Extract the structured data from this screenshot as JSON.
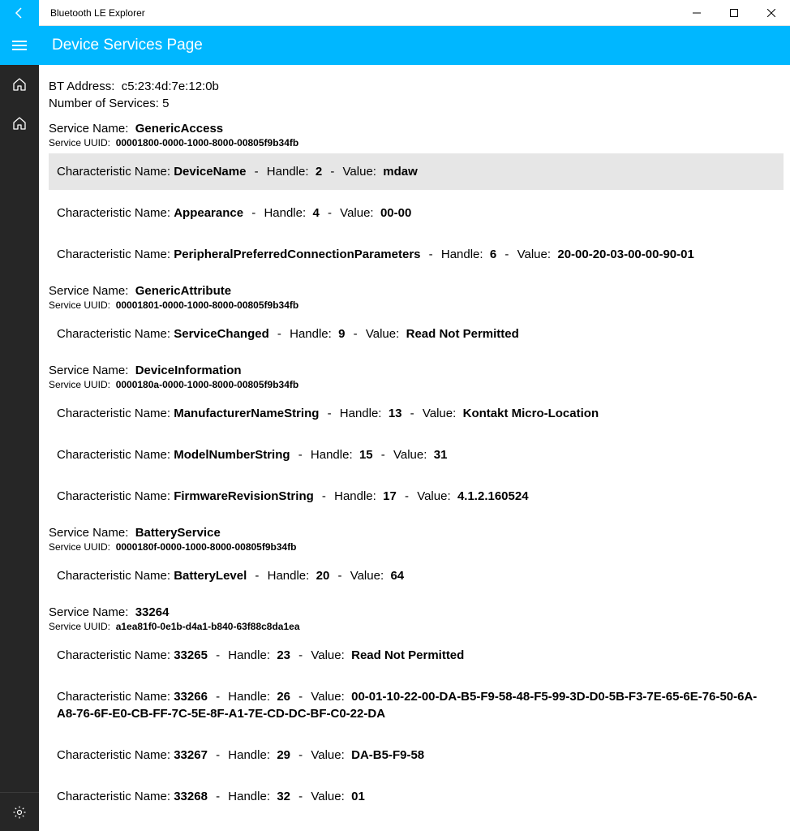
{
  "window": {
    "title": "Bluetooth LE Explorer"
  },
  "appbar": {
    "title": "Device Services Page"
  },
  "meta": {
    "bt_address_label": "BT Address:",
    "bt_address_value": "c5:23:4d:7e:12:0b",
    "num_services_label": "Number of Services:",
    "num_services_value": "5"
  },
  "labels": {
    "service_name": "Service Name:",
    "service_uuid": "Service UUID:",
    "char_name": "Characteristic Name:",
    "handle": "Handle:",
    "value": "Value:"
  },
  "services": [
    {
      "name": "GenericAccess",
      "uuid": "00001800-0000-1000-8000-00805f9b34fb",
      "chars": [
        {
          "name": "DeviceName",
          "handle": "2",
          "value": "mdaw",
          "highlight": true
        },
        {
          "name": "Appearance",
          "handle": "4",
          "value": "00-00"
        },
        {
          "name": "PeripheralPreferredConnectionParameters",
          "handle": "6",
          "value": "20-00-20-03-00-00-90-01"
        }
      ]
    },
    {
      "name": "GenericAttribute",
      "uuid": "00001801-0000-1000-8000-00805f9b34fb",
      "chars": [
        {
          "name": "ServiceChanged",
          "handle": "9",
          "value": "Read Not Permitted"
        }
      ]
    },
    {
      "name": "DeviceInformation",
      "uuid": "0000180a-0000-1000-8000-00805f9b34fb",
      "chars": [
        {
          "name": "ManufacturerNameString",
          "handle": "13",
          "value": "Kontakt Micro-Location"
        },
        {
          "name": "ModelNumberString",
          "handle": "15",
          "value": "31"
        },
        {
          "name": "FirmwareRevisionString",
          "handle": "17",
          "value": "4.1.2.160524"
        }
      ]
    },
    {
      "name": "BatteryService",
      "uuid": "0000180f-0000-1000-8000-00805f9b34fb",
      "chars": [
        {
          "name": "BatteryLevel",
          "handle": "20",
          "value": "64"
        }
      ]
    },
    {
      "name": "33264",
      "uuid": "a1ea81f0-0e1b-d4a1-b840-63f88c8da1ea",
      "chars": [
        {
          "name": "33265",
          "handle": "23",
          "value": "Read Not Permitted"
        },
        {
          "name": "33266",
          "handle": "26",
          "value": "00-01-10-22-00-DA-B5-F9-58-48-F5-99-3D-D0-5B-F3-7E-65-6E-76-50-6A-A8-76-6F-E0-CB-FF-7C-5E-8F-A1-7E-CD-DC-BF-C0-22-DA"
        },
        {
          "name": "33267",
          "handle": "29",
          "value": "DA-B5-F9-58"
        },
        {
          "name": "33268",
          "handle": "32",
          "value": "01"
        }
      ]
    }
  ]
}
